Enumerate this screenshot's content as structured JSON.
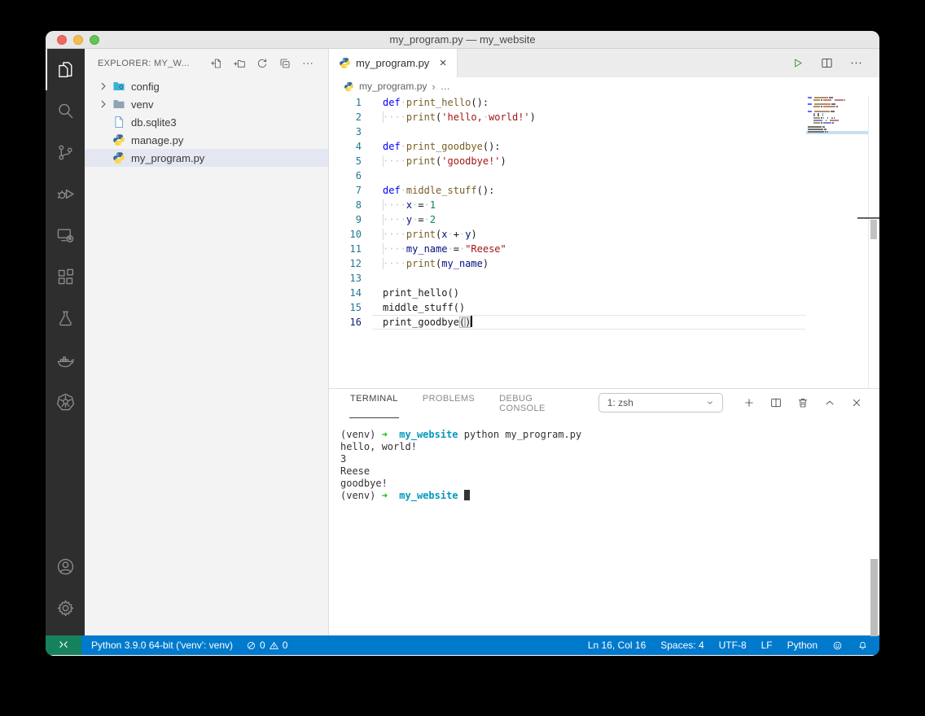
{
  "window": {
    "title": "my_program.py — my_website"
  },
  "colors": {
    "statusbar": "#007acc",
    "remote_indicator": "#16825d",
    "activitybar": "#2e2e2e",
    "titlebar": "#e7e7e7",
    "sidebar": "#f3f3f3",
    "tab_active": "#ffffff",
    "tabbar": "#ececec",
    "selection": "#e4e6f1",
    "run_button": "#388a34",
    "syntax": {
      "keyword": "#0000ff",
      "function": "#795E26",
      "string": "#a31515",
      "number": "#098658",
      "variable": "#001080",
      "default": "#1a1a1a"
    },
    "terminal": {
      "green": "#00bc00",
      "cyan": "#0598bc",
      "text": "#333333"
    }
  },
  "activity_bar": {
    "items": [
      {
        "name": "explorer",
        "icon": "files-icon",
        "active": true
      },
      {
        "name": "search",
        "icon": "search-icon"
      },
      {
        "name": "source-control",
        "icon": "source-control-icon"
      },
      {
        "name": "run-debug",
        "icon": "run-debug-icon"
      },
      {
        "name": "remote-explorer",
        "icon": "remote-explorer-icon"
      },
      {
        "name": "extensions",
        "icon": "extensions-icon"
      },
      {
        "name": "testing",
        "icon": "testing-icon"
      },
      {
        "name": "docker",
        "icon": "docker-icon"
      },
      {
        "name": "kubernetes",
        "icon": "kubernetes-icon"
      }
    ],
    "bottom_items": [
      {
        "name": "account",
        "icon": "account-icon"
      },
      {
        "name": "settings",
        "icon": "settings-icon"
      }
    ]
  },
  "sidebar": {
    "header_title": "EXPLORER: MY_W...",
    "actions": [
      "new-file",
      "new-folder",
      "refresh",
      "collapse-all",
      "more"
    ],
    "tree": [
      {
        "label": "config",
        "icon": "config-folder-icon",
        "chevron": true,
        "selected": false
      },
      {
        "label": "venv",
        "icon": "folder-icon",
        "chevron": true,
        "selected": false
      },
      {
        "label": "db.sqlite3",
        "icon": "file-icon",
        "chevron": false,
        "selected": false
      },
      {
        "label": "manage.py",
        "icon": "python-icon",
        "chevron": false,
        "selected": false
      },
      {
        "label": "my_program.py",
        "icon": "python-icon",
        "chevron": false,
        "selected": true
      }
    ]
  },
  "editor": {
    "tabs": [
      {
        "label": "my_program.py",
        "icon": "python-icon",
        "active": true
      }
    ],
    "toolbar": [
      "run-python",
      "split-editor",
      "more-actions"
    ],
    "breadcrumb": {
      "file": "my_program.py",
      "tail": "…"
    },
    "active_line": 16,
    "code": [
      [
        [
          "def",
          "kw"
        ],
        [
          "·",
          "ws"
        ],
        [
          "print_hello",
          "fn"
        ],
        [
          "():",
          "pl"
        ]
      ],
      [
        [
          "····",
          "in"
        ],
        [
          "print",
          "fn"
        ],
        [
          "(",
          "pl"
        ],
        [
          "'hello,",
          "str"
        ],
        [
          "·",
          "ws"
        ],
        [
          "world!'",
          "str"
        ],
        [
          ")",
          "pl"
        ]
      ],
      [],
      [
        [
          "def",
          "kw"
        ],
        [
          "·",
          "ws"
        ],
        [
          "print_goodbye",
          "fn"
        ],
        [
          "():",
          "pl"
        ]
      ],
      [
        [
          "····",
          "in"
        ],
        [
          "print",
          "fn"
        ],
        [
          "(",
          "pl"
        ],
        [
          "'goodbye!'",
          "str"
        ],
        [
          ")",
          "pl"
        ]
      ],
      [],
      [
        [
          "def",
          "kw"
        ],
        [
          "·",
          "ws"
        ],
        [
          "middle_stuff",
          "fn"
        ],
        [
          "():",
          "pl"
        ]
      ],
      [
        [
          "····",
          "in"
        ],
        [
          "x",
          "var"
        ],
        [
          "·",
          "ws"
        ],
        [
          "=",
          "pl"
        ],
        [
          "·",
          "ws"
        ],
        [
          "1",
          "num"
        ]
      ],
      [
        [
          "····",
          "in"
        ],
        [
          "y",
          "var"
        ],
        [
          "·",
          "ws"
        ],
        [
          "=",
          "pl"
        ],
        [
          "·",
          "ws"
        ],
        [
          "2",
          "num"
        ]
      ],
      [
        [
          "····",
          "in"
        ],
        [
          "print",
          "fn"
        ],
        [
          "(",
          "pl"
        ],
        [
          "x",
          "var"
        ],
        [
          "·",
          "ws"
        ],
        [
          "+",
          "pl"
        ],
        [
          "·",
          "ws"
        ],
        [
          "y",
          "var"
        ],
        [
          ")",
          "pl"
        ]
      ],
      [
        [
          "····",
          "in"
        ],
        [
          "my_name",
          "var"
        ],
        [
          "·",
          "ws"
        ],
        [
          "=",
          "pl"
        ],
        [
          "·",
          "ws"
        ],
        [
          "\"Reese\"",
          "str"
        ]
      ],
      [
        [
          "····",
          "in"
        ],
        [
          "print",
          "fn"
        ],
        [
          "(",
          "pl"
        ],
        [
          "my_name",
          "var"
        ],
        [
          ")",
          "pl"
        ]
      ],
      [],
      [
        [
          "print_hello",
          "pl"
        ],
        [
          "()",
          "pl"
        ]
      ],
      [
        [
          "middle_stuff",
          "pl"
        ],
        [
          "()",
          "pl"
        ]
      ],
      [
        [
          "print_goodbye",
          "pl"
        ],
        [
          "(",
          "bm"
        ],
        [
          ")",
          "bm"
        ],
        [
          "",
          "cursor"
        ]
      ]
    ]
  },
  "terminal": {
    "tabs": [
      {
        "label": "TERMINAL",
        "active": true
      },
      {
        "label": "PROBLEMS",
        "active": false
      },
      {
        "label": "DEBUG CONSOLE",
        "active": false
      }
    ],
    "shell_select_value": "1: zsh",
    "actions": [
      "new-terminal",
      "split-terminal",
      "kill-terminal",
      "maximize-panel",
      "close-panel"
    ],
    "lines": [
      [
        [
          "(venv) ",
          "d"
        ],
        [
          "➜",
          "g"
        ],
        [
          "  ",
          "d"
        ],
        [
          "my_website",
          "c"
        ],
        [
          " python my_program.py",
          "d"
        ]
      ],
      [
        [
          "hello, world!",
          "d"
        ]
      ],
      [
        [
          "3",
          "d"
        ]
      ],
      [
        [
          "Reese",
          "d"
        ]
      ],
      [
        [
          "goodbye!",
          "d"
        ]
      ],
      [
        [
          "(venv) ",
          "d"
        ],
        [
          "➜",
          "g"
        ],
        [
          "  ",
          "d"
        ],
        [
          "my_website",
          "c"
        ],
        [
          " ",
          "d"
        ],
        [
          "",
          "cur"
        ]
      ]
    ]
  },
  "status_bar": {
    "interpreter": "Python 3.9.0 64-bit ('venv': venv)",
    "errors": "0",
    "warnings": "0",
    "right_items": [
      "Ln 16, Col 16",
      "Spaces: 4",
      "UTF-8",
      "LF",
      "Python"
    ]
  }
}
